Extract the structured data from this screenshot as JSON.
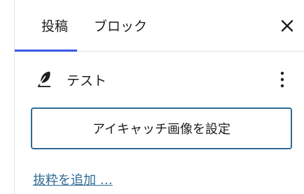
{
  "tabs": {
    "post_label": "投稿",
    "block_label": "ブロック"
  },
  "summary": {
    "title": "テスト"
  },
  "featured_image": {
    "button_label": "アイキャッチ画像を設定"
  },
  "excerpt": {
    "link_label": "抜粋を追加 …"
  },
  "colors": {
    "accent": "#3858e9",
    "link": "#2f6b94",
    "border": "#e0e0e0"
  },
  "icons": [
    "close-icon",
    "feather-icon",
    "more-vertical-icon"
  ]
}
